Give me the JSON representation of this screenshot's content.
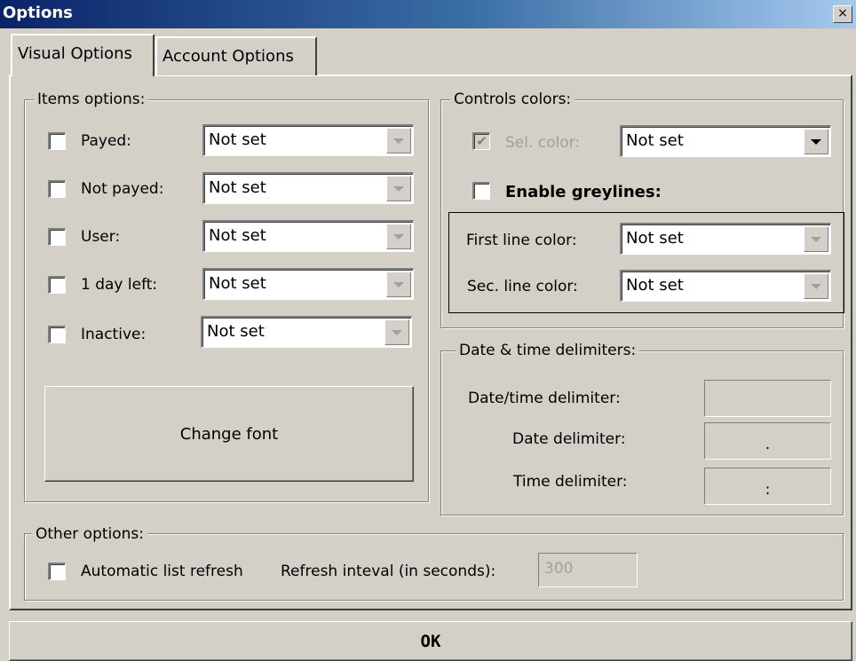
{
  "window": {
    "title": "Options",
    "close_glyph": "×"
  },
  "tabs": [
    {
      "label": "Visual Options",
      "active": true
    },
    {
      "label": "Account Options",
      "active": false
    }
  ],
  "items_options": {
    "legend": "Items options:",
    "rows": [
      {
        "label": "Payed:",
        "checked": false,
        "value": "Not set"
      },
      {
        "label": "Not payed:",
        "checked": false,
        "value": "Not set"
      },
      {
        "label": "User:",
        "checked": false,
        "value": "Not set"
      },
      {
        "label": "1 day left:",
        "checked": false,
        "value": "Not set"
      },
      {
        "label": "Inactive:",
        "checked": false,
        "value": "Not set"
      }
    ],
    "change_font_label": "Change font"
  },
  "controls_colors": {
    "legend": "Controls colors:",
    "sel_color_label": "Sel. color:",
    "sel_color_checked": true,
    "sel_color_value": "Not set",
    "enable_greylines_label": "Enable greylines:",
    "enable_greylines_checked": false,
    "first_line_label": "First line color:",
    "first_line_value": "Not set",
    "sec_line_label": "Sec. line color:",
    "sec_line_value": "Not set"
  },
  "date_time": {
    "legend": "Date & time delimiters:",
    "datetime_label": "Date/time delimiter:",
    "datetime_value": "",
    "date_label": "Date delimiter:",
    "date_value": ".",
    "time_label": "Time delimiter:",
    "time_value": ":"
  },
  "other_options": {
    "legend": "Other options:",
    "auto_refresh_label": "Automatic list refresh",
    "auto_refresh_checked": false,
    "refresh_interval_label": "Refresh inteval (in seconds):",
    "refresh_interval_value": "300"
  },
  "ok_label": "OK",
  "check_glyph": "✔"
}
